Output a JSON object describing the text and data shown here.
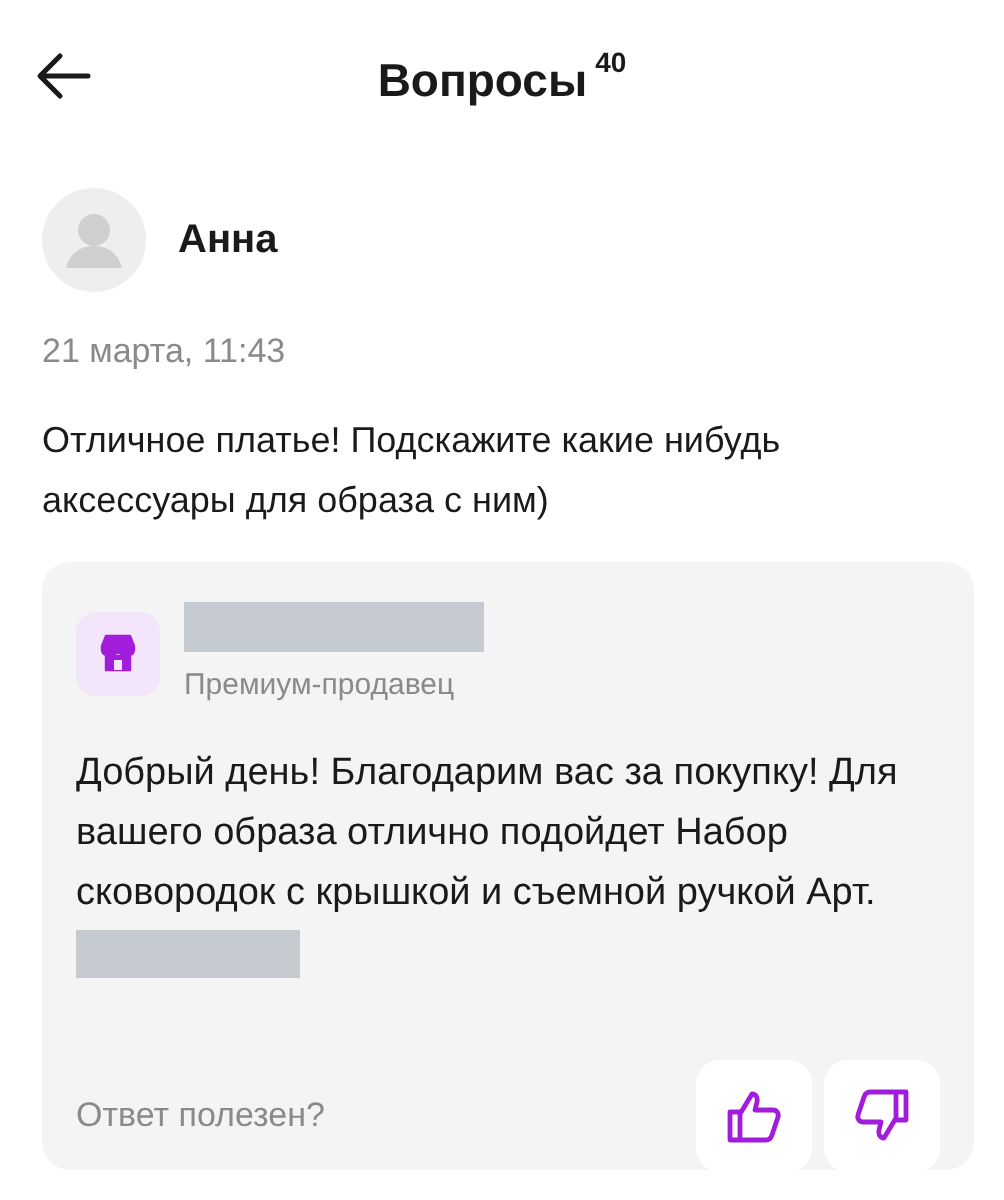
{
  "header": {
    "title": "Вопросы",
    "count": "40"
  },
  "question": {
    "author": "Анна",
    "date": "21 марта, 11:43",
    "text": "Отличное платье! Подскажите какие нибудь аксессуары для образа с ним)"
  },
  "answer": {
    "seller_badge": "Премиум-продавец",
    "text": "Добрый день! Благодарим вас за покупку! Для вашего образа отлично подойдет Набор сковородок с крышкой и съемной ручкой Арт.",
    "feedback_prompt": "Ответ полезен?"
  }
}
